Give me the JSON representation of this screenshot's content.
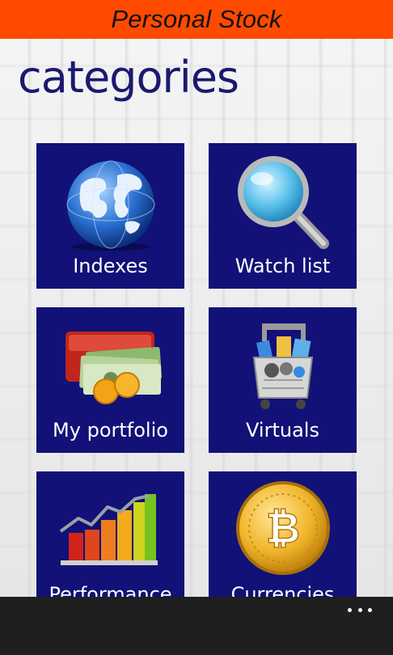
{
  "app": {
    "title": "Personal Stock"
  },
  "page": {
    "title": "categories"
  },
  "tiles": [
    {
      "label": "Indexes",
      "icon": "globe-icon"
    },
    {
      "label": "Watch list",
      "icon": "magnifier-icon"
    },
    {
      "label": "My portfolio",
      "icon": "wallet-money-icon"
    },
    {
      "label": "Virtuals",
      "icon": "shopping-cart-icon"
    },
    {
      "label": "Performance",
      "icon": "bar-chart-icon"
    },
    {
      "label": "Currencies",
      "icon": "bitcoin-icon"
    }
  ],
  "colors": {
    "topbar": "#ff4a00",
    "tile": "#111178",
    "title": "#1a1a6e",
    "appbar": "#1f1f1f"
  }
}
